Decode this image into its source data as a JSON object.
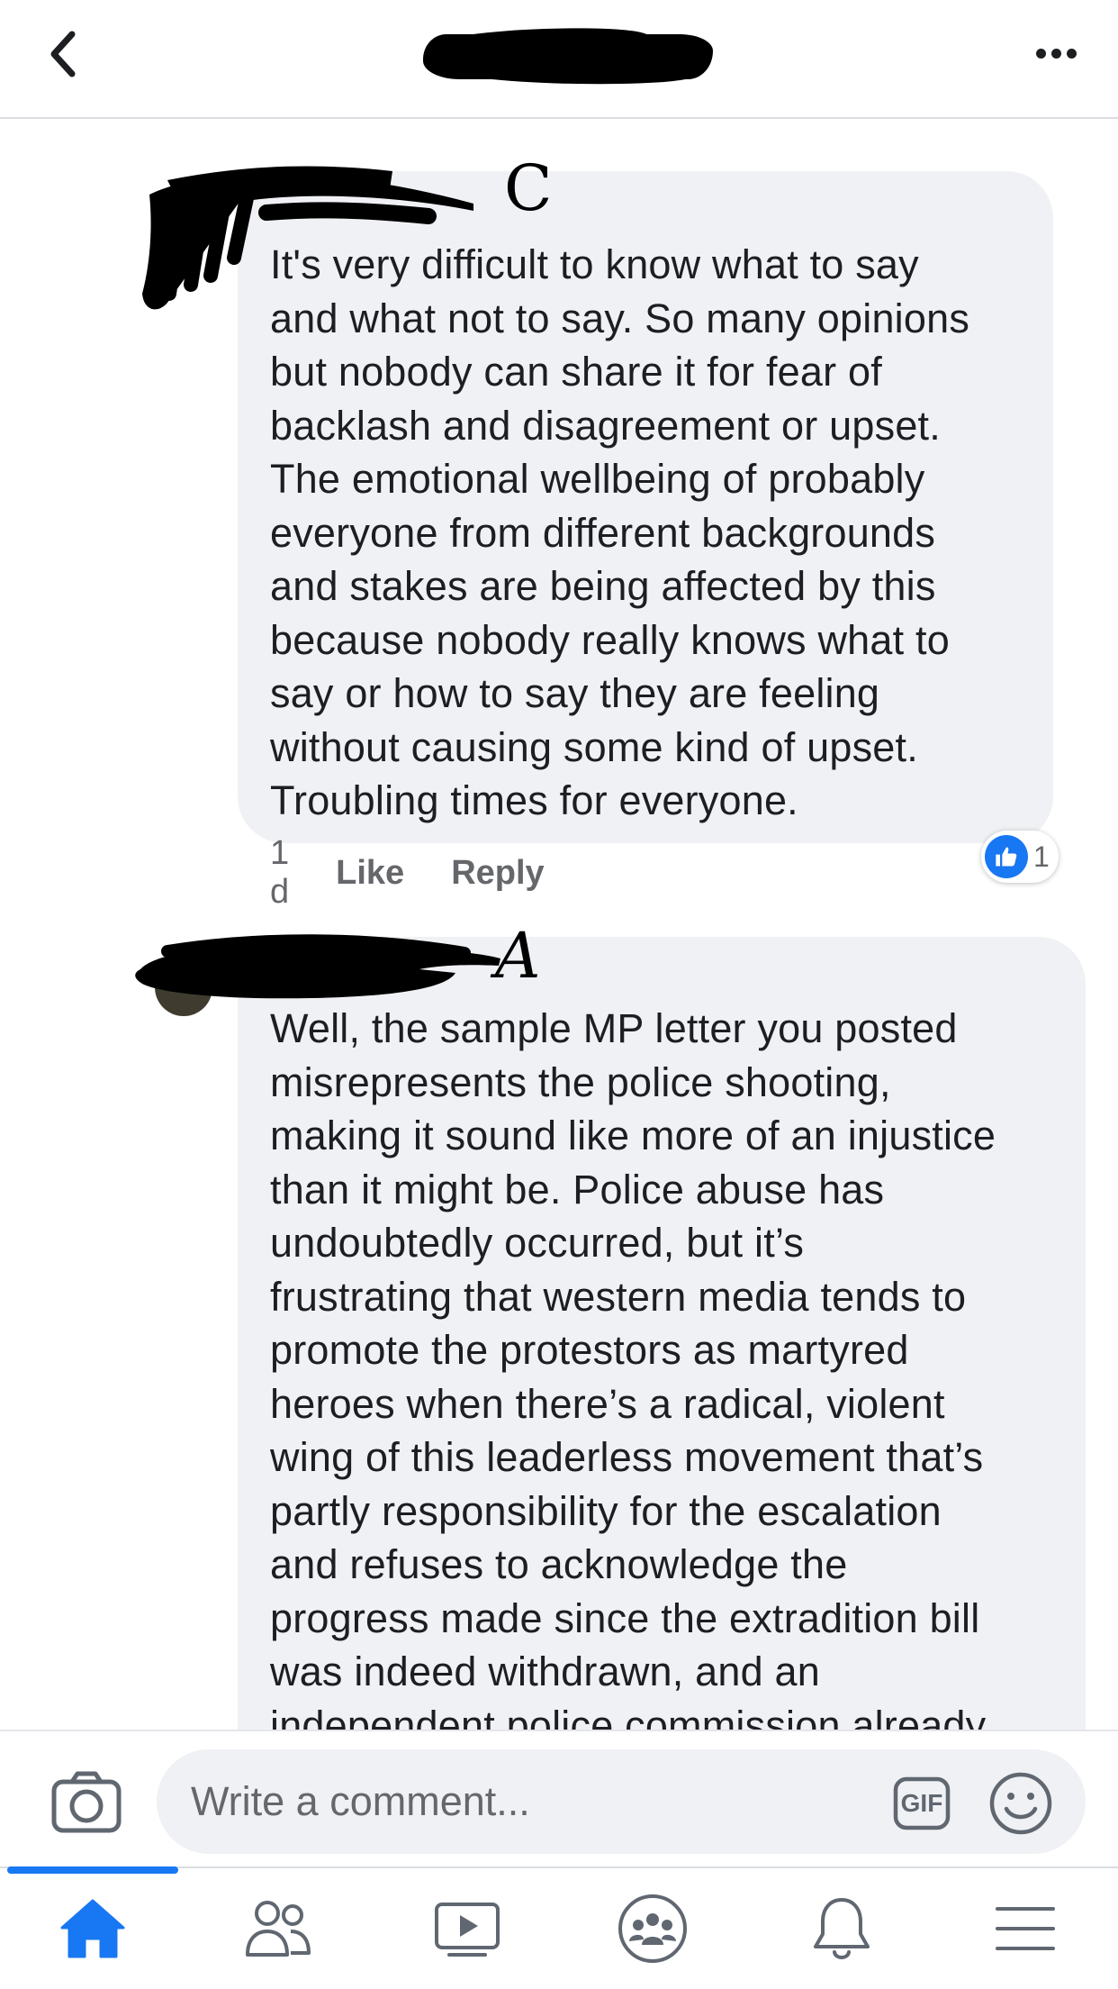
{
  "header": {
    "title": "",
    "back_icon": "chevron-left-icon",
    "more_icon": "more-dots-icon"
  },
  "comments": [
    {
      "author_initial": "C",
      "text": "It's very difficult to know what to say\nand what not to say. So many opinions\nbut nobody can share it for fear of\nbacklash and disagreement or upset.\nThe emotional wellbeing of probably\neveryone from different backgrounds\nand stakes are being affected by this\nbecause nobody really knows what to\nsay or how to say they are feeling\nwithout causing some kind of upset.\nTroubling times for everyone.",
      "time": "1 d",
      "like_label": "Like",
      "reply_label": "Reply",
      "reaction_count": "1"
    },
    {
      "author_initial": "A",
      "text": "Well, the sample MP letter you posted\nmisrepresents the police shooting,\nmaking it sound like more of an injustice\nthan it might be. Police abuse has\nundoubtedly occurred, but it’s\nfrustrating that western media tends to\npromote the protestors as martyred\nheroes when there’s a radical, violent\nwing of this leaderless movement that’s\npartly responsibility for the escalation\nand refuses to acknowledge the\nprogress made since the extradition bill\nwas indeed withdrawn, and an\nindependent police commission already"
    }
  ],
  "composer": {
    "placeholder": "Write a comment...",
    "gif_label": "GIF"
  },
  "tabs": [
    {
      "name": "home",
      "icon": "home-icon",
      "active": true
    },
    {
      "name": "friends",
      "icon": "friends-icon",
      "active": false
    },
    {
      "name": "watch",
      "icon": "video-play-icon",
      "active": false
    },
    {
      "name": "groups",
      "icon": "groups-icon",
      "active": false
    },
    {
      "name": "notifications",
      "icon": "bell-icon",
      "active": false
    },
    {
      "name": "menu",
      "icon": "hamburger-menu-icon",
      "active": false
    }
  ],
  "colors": {
    "accent": "#1877f2",
    "bubble": "#f0f1f4",
    "icon": "#606770",
    "meta_text": "#65676b"
  }
}
